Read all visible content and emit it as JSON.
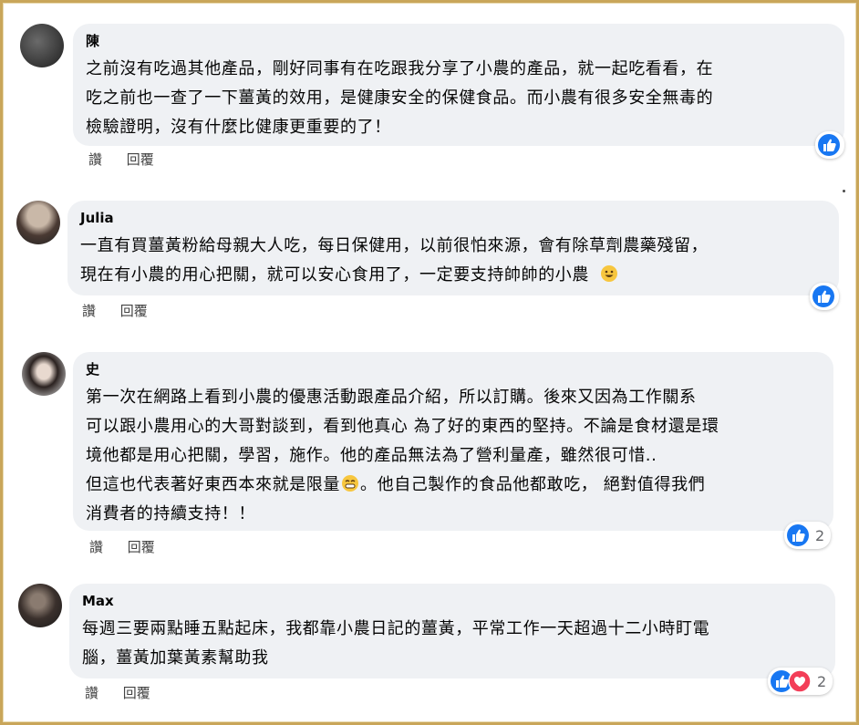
{
  "comments": [
    {
      "name": "陳",
      "lines": [
        "之前沒有吃過其他產品，剛好同事有在吃跟我分享了小農的產品，就一起吃看看，在",
        "吃之前也一查了一下薑黃的效用，是健康安全的保健食品。而小農有很多安全無毒的",
        "檢驗證明，沒有什麼比健康更重要的了！"
      ],
      "read": "讚",
      "reply": "回覆",
      "reactions": [
        "like"
      ],
      "reaction_count": ""
    },
    {
      "name": "Julia",
      "lines": [
        "一直有買薑黃粉給母親大人吃，每日保健用，以前很怕來源，會有除草劑農藥殘留，",
        "現在有小農的用心把關，就可以安心食用了，一定要支持帥帥的小農"
      ],
      "emoji": "smiley",
      "read": "讚",
      "reply": "回覆",
      "reactions": [
        "like"
      ],
      "reaction_count": ""
    },
    {
      "name": "史",
      "lines": [
        "第一次在網路上看到小農的優惠活動跟產品介紹，所以訂購。後來又因為工作關系",
        "可以跟小農用心的大哥對談到，看到他真心 為了好的東西的堅持。不論是食材還是環",
        "境他都是用心把關，學習，施作。他的產品無法為了營利量產，雖然很可惜..",
        "但這也代表著好東西本來就是限量",
        "消費者的持續支持！！"
      ],
      "line4_tail": "。他自己製作的食品他都敢吃， 絕對值得我們",
      "emoji": "grin",
      "read": "讚",
      "reply": "回覆",
      "reactions": [
        "like"
      ],
      "reaction_count": "2"
    },
    {
      "name": "Max",
      "lines": [
        "每週三要兩點睡五點起床，我都靠小農日記的薑黃，平常工作一天超過十二小時盯電",
        "腦，薑黃加葉黃素幫助我"
      ],
      "read": "讚",
      "reply": "回覆",
      "reactions": [
        "like",
        "love"
      ],
      "reaction_count": "2"
    }
  ],
  "colors": {
    "like": "#1877f2",
    "love": "#f33e58",
    "bubble": "#eff1f4",
    "frame": "#c9a65a"
  }
}
